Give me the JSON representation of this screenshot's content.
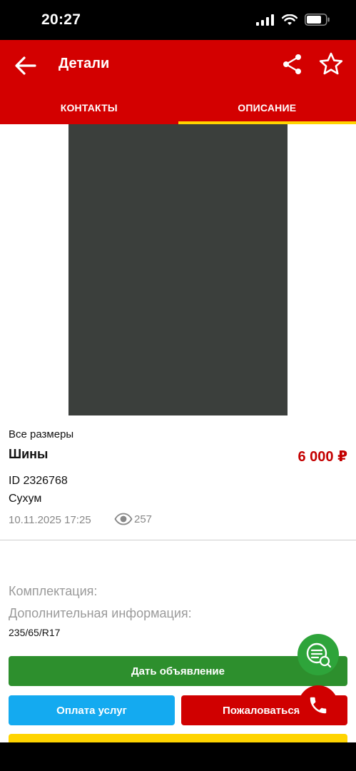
{
  "status_bar": {
    "time": "20:27"
  },
  "header": {
    "title": "Детали",
    "tabs": [
      {
        "label": "КОНТАКТЫ",
        "active": false
      },
      {
        "label": "ОПИСАНИЕ",
        "active": true
      }
    ]
  },
  "listing": {
    "category": "Все размеры",
    "name": "Шины",
    "price": "6 000 ₽",
    "id": "ID 2326768",
    "city": "Сухум",
    "date": "10.11.2025 17:25",
    "views": "257"
  },
  "details": {
    "equipment_label": "Комплектация:",
    "extra_info_label": "Дополнительная информация:",
    "extra_info_value": "235/65/R17"
  },
  "actions": {
    "post_ad": "Дать объявление",
    "pay_services": "Оплата услуг",
    "report": "Пожаловаться"
  },
  "colors": {
    "brand_red": "#d30000",
    "tab_indicator": "#ffd400",
    "price_red": "#c40000",
    "post_green": "#2d8f2d",
    "pay_blue": "#14aaf0"
  }
}
